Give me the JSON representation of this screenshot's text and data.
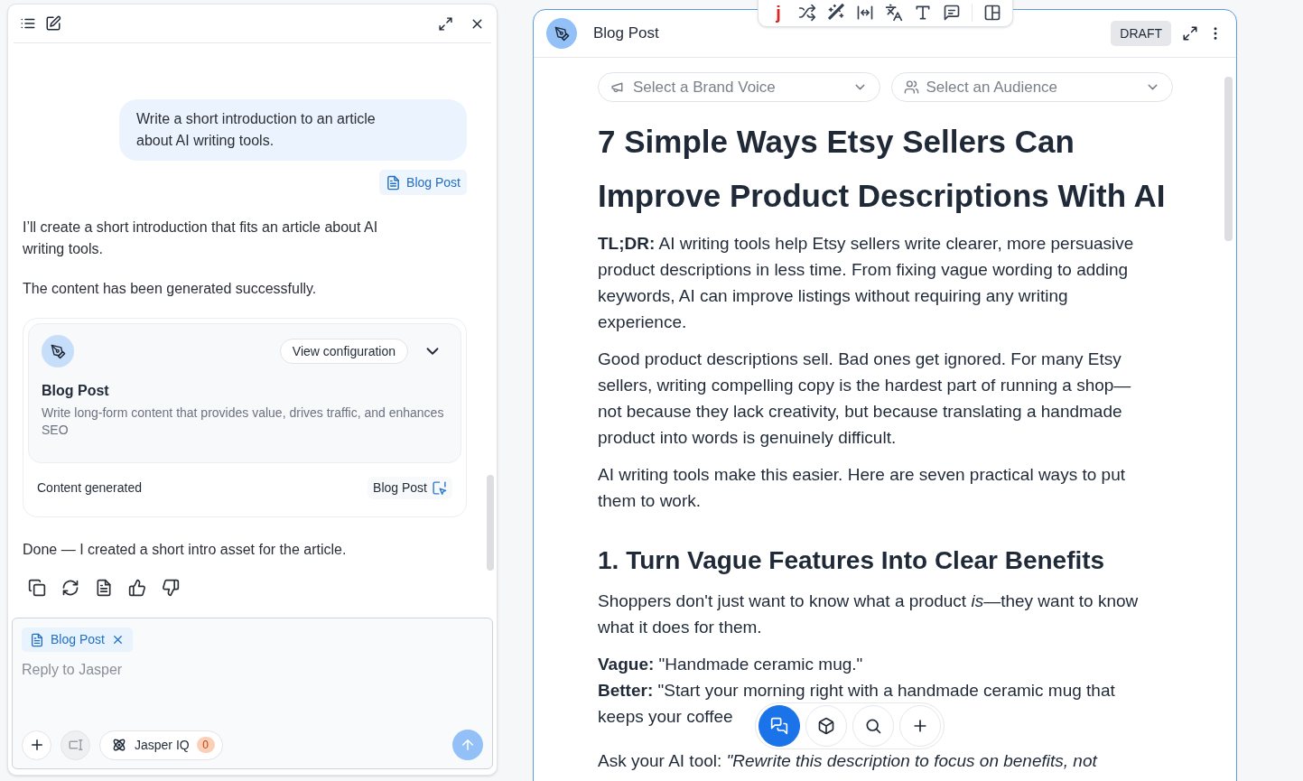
{
  "chat": {
    "messages": [
      {
        "kind": "user",
        "text": "Write a short introduction to an article about AI writing tools."
      },
      {
        "kind": "attachment",
        "label": "Blog Post"
      },
      {
        "kind": "assistant",
        "text": "I’ll create a short introduction that fits an article about AI writing tools."
      },
      {
        "kind": "assistant",
        "text": "The content has been generated successfully."
      },
      {
        "kind": "asset",
        "title": "Blog Post",
        "description": "Write long-form content that provides value, drives traffic, and enhances SEO",
        "button": "View configuration",
        "status": "Content generated",
        "link": "Blog Post"
      },
      {
        "kind": "assistant",
        "text": "Done — I created a short intro asset for the article."
      },
      {
        "kind": "actions"
      }
    ],
    "composer": {
      "chip": "Blog Post",
      "placeholder": "Reply to Jasper",
      "iq_label": "Jasper IQ",
      "iq_count": "0"
    }
  },
  "editor": {
    "toolbar": {
      "logo": "j"
    },
    "title": "Blog Post",
    "status": "DRAFT",
    "selects": [
      "Select a Brand Voice",
      "Select an Audience"
    ],
    "article": [
      {
        "kind": "h1",
        "text": "7 Simple Ways Etsy Sellers Can Improve Product Descriptions With AI"
      },
      {
        "kind": "p",
        "text": "**TL;DR:** AI writing tools help Etsy sellers write clearer, more persuasive product descriptions in less time. From fixing vague wording to adding keywords, AI can improve listings without requiring any writing experience."
      },
      {
        "kind": "p",
        "text": "Good product descriptions sell. Bad ones get ignored. For many Etsy sellers, writing compelling copy is the hardest part of running a shop—not because they lack creativity, but because translating a handmade product into words is genuinely difficult."
      },
      {
        "kind": "p",
        "text": "AI writing tools make this easier. Here are seven practical ways to put them to work."
      },
      {
        "kind": "h2",
        "text": "1. Turn Vague Features Into Clear Benefits"
      },
      {
        "kind": "p",
        "text": "Shoppers don't just want to know what a product *is*—they want to know what it does for them."
      },
      {
        "kind": "p",
        "text": "**Vague:** \"Handmade ceramic mug.\""
      },
      {
        "kind": "line",
        "text": "**Better:** \"Start your morning right with a handmade ceramic mug that"
      },
      {
        "kind": "line",
        "text": "keeps your coffee"
      },
      {
        "kind": "p",
        "text": "Ask your AI tool: *\"Rewrite this description to focus on benefits, not*"
      }
    ],
    "dock": [
      {
        "selected": true
      },
      {
        "selected": false
      },
      {
        "selected": false
      },
      {
        "selected": false
      }
    ]
  }
}
